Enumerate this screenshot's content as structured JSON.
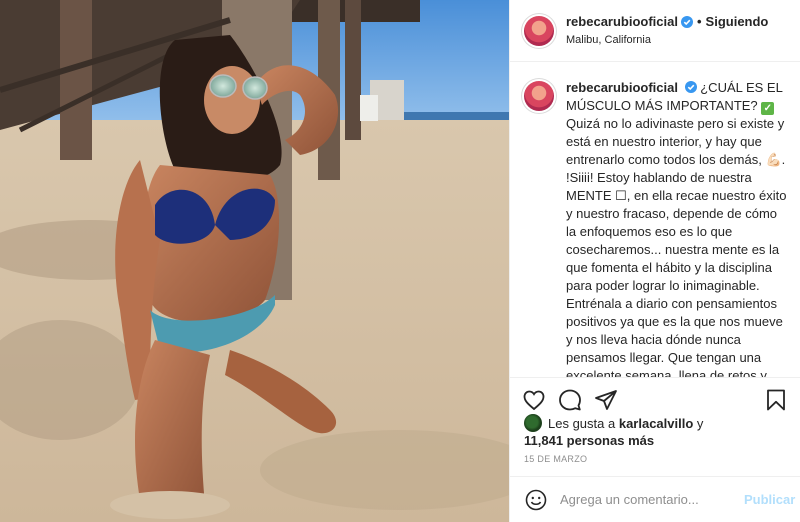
{
  "post": {
    "username": "rebecarubiooficial",
    "separator": "•",
    "follow_label": "Siguiendo",
    "location": "Malibu, California",
    "image_alt": "Mujer en bikini azul arrodillada en la arena de la playa"
  },
  "caption": {
    "username": "rebecarubiooficial",
    "text_1": "¿CUÁL ES EL MÚSCULO MÁS IMPORTANTE?",
    "check_glyph": "✓",
    "text_2": "Quizá no lo adivinaste pero si existe y está en nuestro interior, y hay que entrenarlo como todos los demás,",
    "flex_emoji": "💪🏻",
    "text_3": ". !Siiii! Estoy hablando de nuestra MENTE",
    "box_glyph": "☐",
    "text_4": ", en ella recae nuestro éxito y nuestro fracaso, depende de cómo la enfoquemos eso es lo que cosecharemos... nuestra mente es la que fomenta el hábito y la disciplina para poder lograr lo inimaginable. Entrénala a diario con pensamientos positivos ya que es la que nos mueve y nos lleva hacia dónde nunca pensamos llegar. Que tengan una excelente semana, llena de retos y recompensas, ya hoy termina la promo de mi súper Turbo Challenge y"
  },
  "actions": {
    "like_icon": "heart-icon",
    "comment_icon": "comment-icon",
    "share_icon": "share-icon",
    "save_icon": "bookmark-icon"
  },
  "likes": {
    "prefix": "Les gusta a",
    "user": "karlacalvillo",
    "connector": "y",
    "count_text": "11,841 personas más"
  },
  "date": "15 DE MARZO",
  "comment": {
    "placeholder": "Agrega un comentario...",
    "publish_label": "Publicar"
  },
  "colors": {
    "accent_verified": "#3897f0",
    "publish_disabled": "#b2dffc",
    "border": "#efefef"
  }
}
